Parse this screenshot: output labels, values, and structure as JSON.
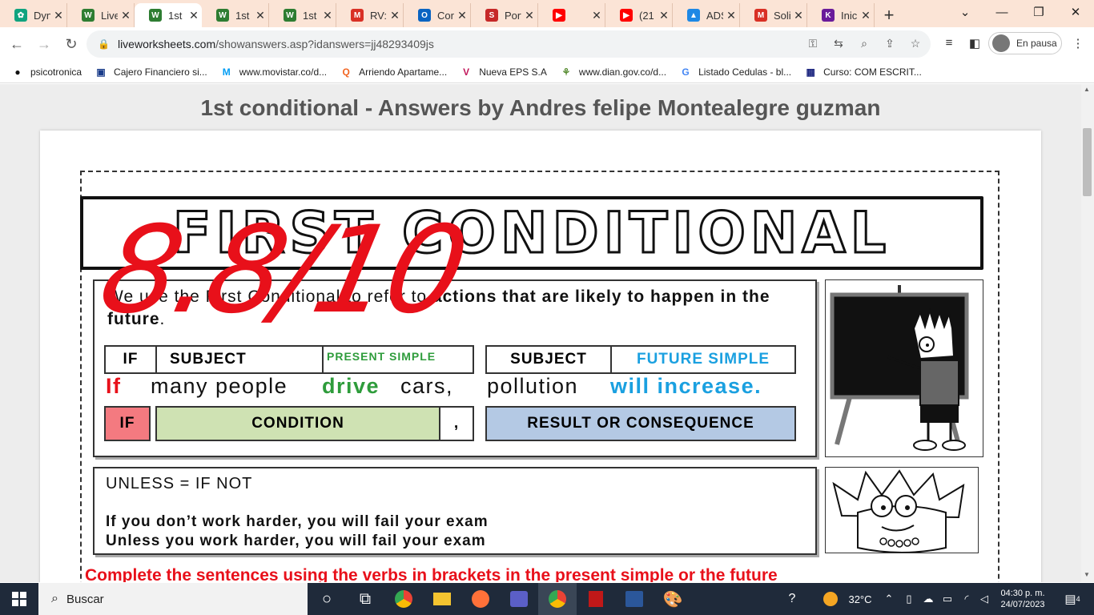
{
  "tabs": [
    {
      "label": "Dyn",
      "color": "#10a37f",
      "glyph": "✿"
    },
    {
      "label": "Live",
      "color": "#2e7d32",
      "glyph": "W"
    },
    {
      "label": "1st",
      "color": "#2e7d32",
      "glyph": "W",
      "active": true
    },
    {
      "label": "1st",
      "color": "#2e7d32",
      "glyph": "W"
    },
    {
      "label": "1st",
      "color": "#2e7d32",
      "glyph": "W"
    },
    {
      "label": "RV:",
      "color": "#d93025",
      "glyph": "M"
    },
    {
      "label": "Cor",
      "color": "#0a64c2",
      "glyph": "O"
    },
    {
      "label": "Port",
      "color": "#c62828",
      "glyph": "S"
    },
    {
      "label": "",
      "color": "#ff0000",
      "glyph": "▶"
    },
    {
      "label": "(21",
      "color": "#ff0000",
      "glyph": "▶"
    },
    {
      "label": "ADS",
      "color": "#1e88e5",
      "glyph": "▲"
    },
    {
      "label": "Soli",
      "color": "#d93025",
      "glyph": "M"
    },
    {
      "label": "Inic",
      "color": "#6a1b9a",
      "glyph": "K"
    }
  ],
  "window": {
    "minimize": "—",
    "maximize": "❐",
    "close": "✕",
    "tab_search": "⌄"
  },
  "url": {
    "host": "liveworksheets.com",
    "path": "/showanswers.asp?idanswers=jj48293409js"
  },
  "profile": {
    "label": "En pausa"
  },
  "bookmarks": [
    {
      "label": "psicotronica",
      "glyph": "●",
      "color": "#111"
    },
    {
      "label": "Cajero Financiero si...",
      "glyph": "▣",
      "color": "#1a3c8a"
    },
    {
      "label": "www.movistar.co/d...",
      "glyph": "M",
      "color": "#019df4"
    },
    {
      "label": "Arriendo Apartame...",
      "glyph": "Q",
      "color": "#f26522"
    },
    {
      "label": "Nueva EPS S.A",
      "glyph": "V",
      "color": "#c2185b"
    },
    {
      "label": "www.dian.gov.co/d...",
      "glyph": "⚘",
      "color": "#558b2f"
    },
    {
      "label": "Listado Cedulas - bl...",
      "glyph": "G",
      "color": "#4285f4"
    },
    {
      "label": "Curso: COM ESCRIT...",
      "glyph": "▦",
      "color": "#1a237e"
    }
  ],
  "page": {
    "title": "1st conditional - Answers by Andres felipe Montealegre guzman",
    "banner": "FIRST CONDITIONAL",
    "score": "8.8/10",
    "intro_a": "We use the First Conditional to refer to ",
    "intro_b": "actions that are likely to happen in the future",
    "intro_c": ".",
    "hdr_if": "IF",
    "hdr_subject": "SUBJECT",
    "hdr_present": "PRESENT SIMPLE",
    "hdr_subject2": "SUBJECT",
    "hdr_future": "FUTURE SIMPLE",
    "ex_if": "If",
    "ex_subj": "many people",
    "ex_verb": "drive",
    "ex_obj": "cars,",
    "ex_subj2": "pollution",
    "ex_future": "will increase.",
    "box_if": "IF",
    "box_condition": "CONDITION",
    "box_comma": ",",
    "box_result": "RESULT OR CONSEQUENCE",
    "unless_title": "UNLESS = IF NOT",
    "unless_line1": "If you don’t work harder, you will fail your exam",
    "unless_line2": "Unless you work harder, you will fail your exam",
    "instructions": "Complete the sentences using the verbs in brackets in the present simple or the future"
  },
  "colors": {
    "red": "#e8101a",
    "green": "#2e9c3b",
    "blue": "#1aa0e0",
    "if_box": "#f47a80",
    "condition_box": "#cfe2b3",
    "result_box": "#b4c9e4"
  },
  "taskbar": {
    "search": "Buscar",
    "temp": "32°C",
    "time": "04:30 p. m.",
    "date": "24/07/2023",
    "notif": "4"
  }
}
